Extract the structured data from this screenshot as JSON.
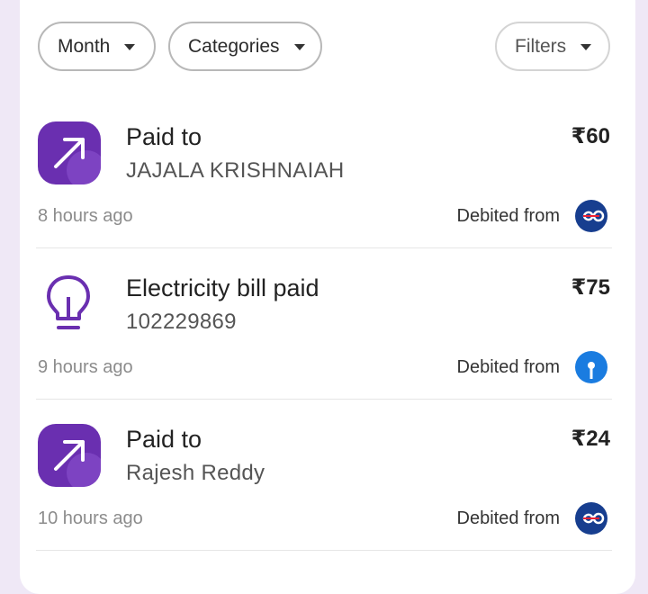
{
  "filters": {
    "month_label": "Month",
    "categories_label": "Categories",
    "filters_label": "Filters"
  },
  "transactions": [
    {
      "title": "Paid to",
      "subtitle": "JAJALA KRISHNAIAH",
      "amount": "₹60",
      "time": "8 hours ago",
      "debited_label": "Debited from",
      "icon": "arrow-up-right-icon",
      "bank_icon": "kotak-bank-icon"
    },
    {
      "title": "Electricity bill paid",
      "subtitle": "102229869",
      "amount": "₹75",
      "time": "9 hours ago",
      "debited_label": "Debited from",
      "icon": "lightbulb-icon",
      "bank_icon": "sbi-bank-icon"
    },
    {
      "title": "Paid to",
      "subtitle": "Rajesh Reddy",
      "amount": "₹24",
      "time": "10 hours ago",
      "debited_label": "Debited from",
      "icon": "arrow-up-right-icon",
      "bank_icon": "kotak-bank-icon"
    }
  ],
  "colors": {
    "accent_purple": "#6a2fb0",
    "kotak_blue": "#173e8f",
    "sbi_blue": "#1a7ce0",
    "background": "#efe8f6"
  }
}
